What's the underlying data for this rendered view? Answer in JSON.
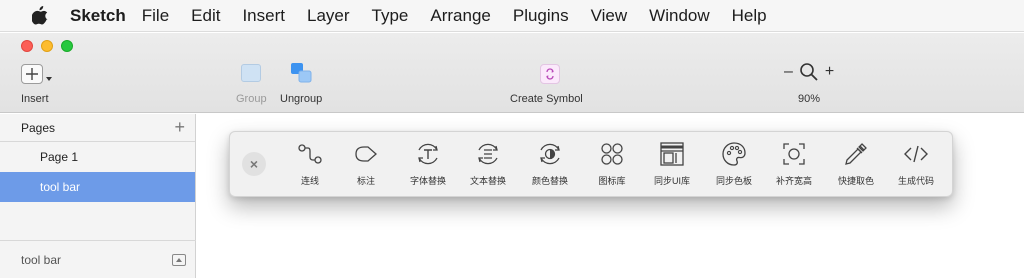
{
  "menubar": {
    "items": [
      "Sketch",
      "File",
      "Edit",
      "Insert",
      "Layer",
      "Type",
      "Arrange",
      "Plugins",
      "View",
      "Window",
      "Help"
    ]
  },
  "toolbar": {
    "insert_label": "Insert",
    "group_label": "Group",
    "ungroup_label": "Ungroup",
    "create_symbol_label": "Create Symbol",
    "zoom_minus": "–",
    "zoom_plus": "+",
    "zoom_level": "90%"
  },
  "sidebar": {
    "pages_title": "Pages",
    "add_symbol": "+",
    "pages": [
      "Page 1",
      "tool bar"
    ],
    "footer_label": "tool bar"
  },
  "floating_toolbar": {
    "items": [
      {
        "label": "连线",
        "icon": "connector-icon"
      },
      {
        "label": "标注",
        "icon": "annotation-icon"
      },
      {
        "label": "字体替换",
        "icon": "font-replace-icon"
      },
      {
        "label": "文本替换",
        "icon": "text-replace-icon"
      },
      {
        "label": "颜色替换",
        "icon": "color-replace-icon"
      },
      {
        "label": "图标库",
        "icon": "icon-library-icon"
      },
      {
        "label": "同步UI库",
        "icon": "sync-ui-library-icon"
      },
      {
        "label": "同步色板",
        "icon": "sync-palette-icon"
      },
      {
        "label": "补齐宽高",
        "icon": "fill-size-icon"
      },
      {
        "label": "快捷取色",
        "icon": "eyedropper-icon"
      },
      {
        "label": "生成代码",
        "icon": "code-icon"
      }
    ]
  },
  "colors": {
    "selection": "#6d9be8",
    "traffic_red": "#fc5f57",
    "traffic_yellow": "#fdbc2e",
    "traffic_green": "#28c840"
  }
}
